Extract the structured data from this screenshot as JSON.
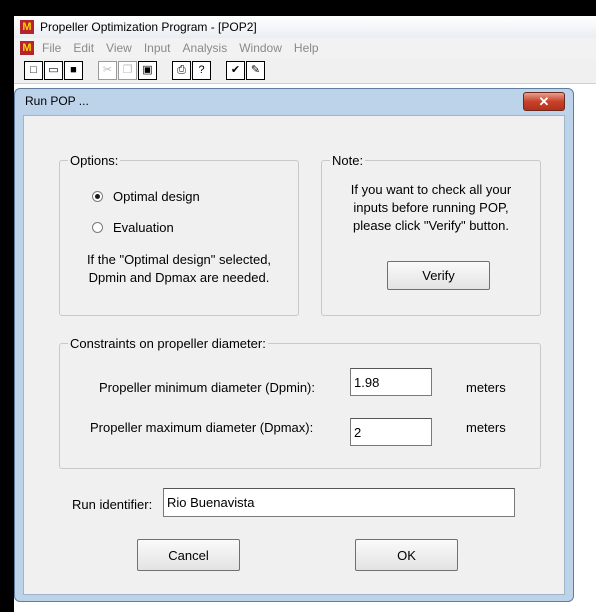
{
  "app": {
    "title": "Propeller Optimization Program - [POP2]",
    "icon_letter": "M",
    "menu": [
      "File",
      "Edit",
      "View",
      "Input",
      "Analysis",
      "Window",
      "Help"
    ]
  },
  "dialog": {
    "title": "Run POP ...",
    "options": {
      "label": "Options:",
      "optimal": "Optimal design",
      "evaluation": "Evaluation",
      "selected": "optimal",
      "hint_line1": "If the \"Optimal design\" selected,",
      "hint_line2": "Dpmin and Dpmax are needed."
    },
    "note": {
      "label": "Note:",
      "line1": "If you want to check all your",
      "line2": "inputs before running POP,",
      "line3": "please click \"Verify\" button.",
      "verify_label": "Verify"
    },
    "constraints": {
      "label": "Constraints on propeller diameter:",
      "dpmin_label": "Propeller minimum diameter (Dpmin):",
      "dpmin_value": "1.98",
      "dpmin_unit": "meters",
      "dpmax_label": "Propeller maximum diameter (Dpmax):",
      "dpmax_value": "2",
      "dpmax_unit": "meters"
    },
    "run_identifier": {
      "label": "Run identifier:",
      "value": "Rio Buenavista"
    },
    "cancel_label": "Cancel",
    "ok_label": "OK"
  }
}
